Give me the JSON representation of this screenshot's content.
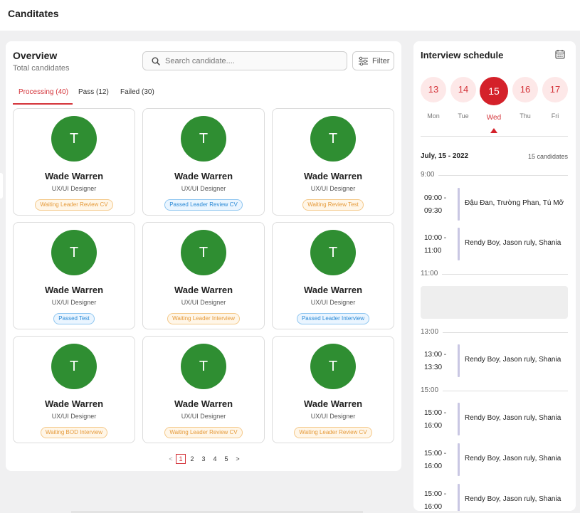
{
  "header": {
    "title": "Canditates"
  },
  "overview": {
    "title": "Overview",
    "subtitle": "Total candidates",
    "search_placeholder": "Search candidate....",
    "filter_label": "Filter"
  },
  "tabs": [
    {
      "label": "Processing (40)",
      "active": true
    },
    {
      "label": "Pass (12)",
      "active": false
    },
    {
      "label": "Failed (30)",
      "active": false
    }
  ],
  "candidates": [
    {
      "initial": "T",
      "name": "Wade Warren",
      "role": "UX/UI Designer",
      "status": "Waiting Leader Review CV",
      "status_color": "orange"
    },
    {
      "initial": "T",
      "name": "Wade Warren",
      "role": "UX/UI Designer",
      "status": "Passed Leader Review CV",
      "status_color": "blue"
    },
    {
      "initial": "T",
      "name": "Wade Warren",
      "role": "UX/UI Designer",
      "status": "Waiting Review Test",
      "status_color": "orange"
    },
    {
      "initial": "T",
      "name": "Wade Warren",
      "role": "UX/UI Designer",
      "status": "Passed Test",
      "status_color": "blue"
    },
    {
      "initial": "T",
      "name": "Wade Warren",
      "role": "UX/UI Designer",
      "status": "Waiting Leader Interview",
      "status_color": "orange"
    },
    {
      "initial": "T",
      "name": "Wade Warren",
      "role": "UX/UI Designer",
      "status": "Passed Leader Interview",
      "status_color": "blue"
    },
    {
      "initial": "T",
      "name": "Wade Warren",
      "role": "UX/UI Designer",
      "status": "Waiting BOD Interview",
      "status_color": "orange"
    },
    {
      "initial": "T",
      "name": "Wade Warren",
      "role": "UX/UI Designer",
      "status": "Waiting Leader Review CV",
      "status_color": "orange"
    },
    {
      "initial": "T",
      "name": "Wade Warren",
      "role": "UX/UI Designer",
      "status": "Waiting Leader Review CV",
      "status_color": "orange"
    }
  ],
  "pagination": {
    "prev": "<",
    "pages": [
      "1",
      "2",
      "3",
      "4",
      "5"
    ],
    "current": "1",
    "next": ">"
  },
  "schedule": {
    "title": "Interview schedule",
    "days": [
      {
        "num": "13",
        "name": "Mon",
        "selected": false
      },
      {
        "num": "14",
        "name": "Tue",
        "selected": false
      },
      {
        "num": "15",
        "name": "Wed",
        "selected": true
      },
      {
        "num": "16",
        "name": "Thu",
        "selected": false
      },
      {
        "num": "17",
        "name": "Fri",
        "selected": false
      }
    ],
    "date": "July, 15 - 2022",
    "count": "15 candidates",
    "time_markers": [
      "9:00",
      "11:00",
      "13:00",
      "15:00"
    ],
    "events": [
      {
        "start": "09:00 -",
        "end": "09:30",
        "names": "Đậu Đan, Trường Phan, Tú Mỡ"
      },
      {
        "start": "10:00 -",
        "end": "11:00",
        "names": "Rendy Boy, Jason ruly, Shania"
      },
      {
        "start": "13:00 -",
        "end": "13:30",
        "names": "Rendy Boy, Jason ruly, Shania"
      },
      {
        "start": "15:00 -",
        "end": "16:00",
        "names": "Rendy Boy, Jason ruly, Shania"
      },
      {
        "start": "15:00 -",
        "end": "16:00",
        "names": "Rendy Boy, Jason ruly, Shania"
      },
      {
        "start": "15:00 -",
        "end": "16:00",
        "names": "Rendy Boy, Jason ruly, Shania"
      }
    ]
  },
  "colors": {
    "accent": "#d4212a",
    "avatar": "#2f8e32",
    "event_bar": "#c9c7e3"
  }
}
